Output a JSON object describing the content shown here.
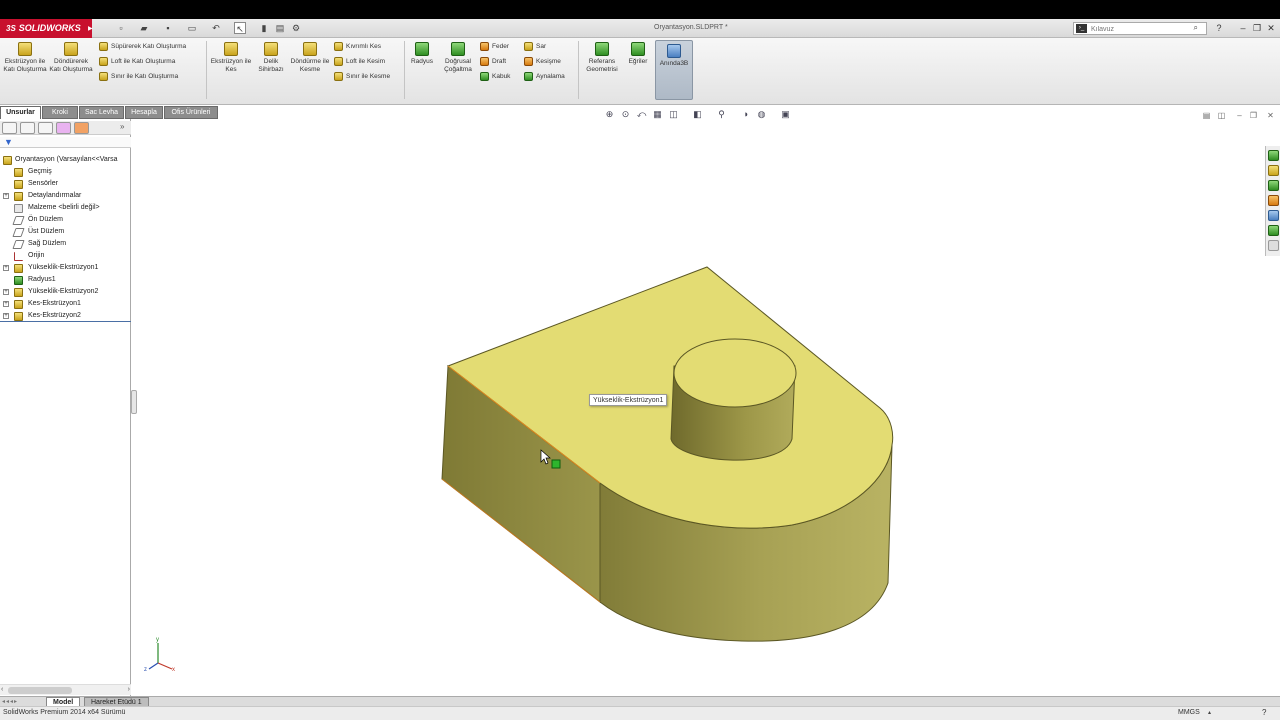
{
  "app": {
    "brand": "SOLIDWORKS",
    "brand_prefix": "3S",
    "document_title": "Oryantasyon.SLDPRT *"
  },
  "search": {
    "placeholder": "Kılavuz"
  },
  "ribbon": {
    "extrude_boss": "Ekstrüzyon ile Katı Oluşturma",
    "revolve_boss": "Döndürerek Katı Oluşturma",
    "sweep_boss": "Süpürerek Katı Oluşturma",
    "loft_boss": "Loft ile Katı Oluşturma",
    "boundary_boss": "Sınır ile Katı Oluşturma",
    "extrude_cut": "Ekstrüzyon ile Kes",
    "hole_wizard": "Delik Sihirbazı",
    "revolve_cut": "Döndürme ile Kesme",
    "swept_cut": "Kıvrımlı Kes",
    "loft_cut": "Loft ile Kesim",
    "boundary_cut": "Sınır ile Kesme",
    "fillet": "Radyus",
    "linear_pattern": "Doğrusal Çoğaltma",
    "rib": "Feder",
    "draft": "Draft",
    "shell": "Kabuk",
    "wrap": "Sar",
    "intersect": "Kesişme",
    "mirror": "Aynalama",
    "ref_geometry": "Referans Geometrisi",
    "curves": "Eğriler",
    "instant3d": "Anında3B"
  },
  "tabs": [
    {
      "label": "Unsurlar"
    },
    {
      "label": "Kroki"
    },
    {
      "label": "Sac Levha"
    },
    {
      "label": "Hesapla"
    },
    {
      "label": "Ofis Ürünleri"
    }
  ],
  "tree": {
    "root": "Oryantasyon  (Varsayılan<<Varsa",
    "items": [
      {
        "label": "Geçmiş"
      },
      {
        "label": "Sensörler"
      },
      {
        "label": "Detaylandırmalar"
      },
      {
        "label": "Malzeme <belirli değil>"
      },
      {
        "label": "Ön Düzlem"
      },
      {
        "label": "Üst Düzlem"
      },
      {
        "label": "Sağ Düzlem"
      },
      {
        "label": "Orijin"
      },
      {
        "label": "Yükseklik-Ekstrüzyon1"
      },
      {
        "label": "Radyus1"
      },
      {
        "label": "Yükseklik-Ekstrüzyon2"
      },
      {
        "label": "Kes-Ekstrüzyon1"
      },
      {
        "label": "Kes-Ekstrüzyon2"
      }
    ]
  },
  "viewport": {
    "tooltip": "Yükseklik-Ekstrüzyon1",
    "axis_labels": {
      "x": "x",
      "y": "y",
      "z": "z"
    },
    "part_color": "#E3DC73",
    "part_side_color": "#8F8A3E"
  },
  "bottom_tabs": [
    {
      "label": "Model"
    },
    {
      "label": "Hareket Etüdü 1"
    }
  ],
  "status": {
    "text": "SolidWorks Premium 2014 x64 Sürümü",
    "units": "MMGS"
  },
  "colors": {
    "brand_red": "#C8102E",
    "accent_blue": "#4A6FA5"
  }
}
